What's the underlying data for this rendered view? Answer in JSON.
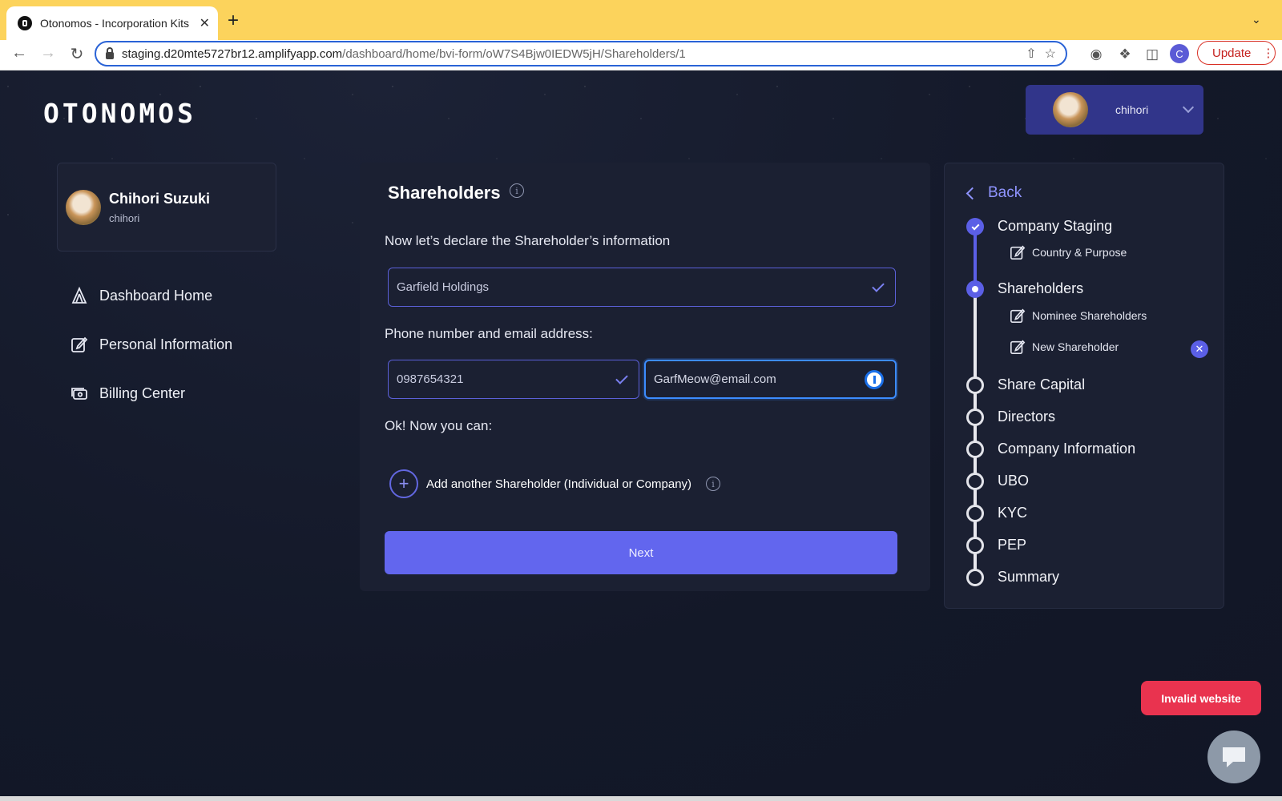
{
  "browser": {
    "tab_title": "Otonomos - Incorporation Kits",
    "new_tab": "+",
    "tab_close": "✕",
    "url_host": "staging.d20mte5727br12.amplifyapp.com",
    "url_path": "/dashboard/home/bvi-form/oW7S4Bjw0IEDW5jH/Shareholders/1",
    "profile_initial": "C",
    "update_label": "Update"
  },
  "app": {
    "logo": "OTONOMOS",
    "user_menu": {
      "name": "chihori"
    }
  },
  "profile": {
    "full_name": "Chihori Suzuki",
    "handle": "chihori"
  },
  "sidebar": {
    "items": [
      {
        "label": "Dashboard Home"
      },
      {
        "label": "Personal Information"
      },
      {
        "label": "Billing Center"
      }
    ]
  },
  "form": {
    "title": "Shareholders",
    "prompt": "Now let’s declare the Shareholder’s information",
    "name_value": "Garfield Holdings",
    "contact_label": "Phone number and email address:",
    "phone_value": "0987654321",
    "email_value": "GarfMeow@email.com",
    "ok_label": "Ok! Now you can:",
    "add_label": "Add another Shareholder (Individual or Company)",
    "next_label": "Next"
  },
  "steps": {
    "back_label": "Back",
    "items": [
      {
        "label": "Company Staging",
        "status": "done"
      },
      {
        "label": "Country & Purpose",
        "sub": true
      },
      {
        "label": "Shareholders",
        "status": "current"
      },
      {
        "label": "Nominee Shareholders",
        "sub": true
      },
      {
        "label": "New Shareholder",
        "sub": true
      },
      {
        "label": "Share Capital",
        "status": "todo"
      },
      {
        "label": "Directors",
        "status": "todo"
      },
      {
        "label": "Company Information",
        "status": "todo"
      },
      {
        "label": "UBO",
        "status": "todo"
      },
      {
        "label": "KYC",
        "status": "todo"
      },
      {
        "label": "PEP",
        "status": "todo"
      },
      {
        "label": "Summary",
        "status": "todo"
      }
    ]
  },
  "toast": {
    "label": "Invalid website"
  },
  "colors": {
    "accent": "#6266ee",
    "background": "#141a2c",
    "card": "#1b2032",
    "error": "#e9334f",
    "browser_frame": "#fcd35c"
  }
}
